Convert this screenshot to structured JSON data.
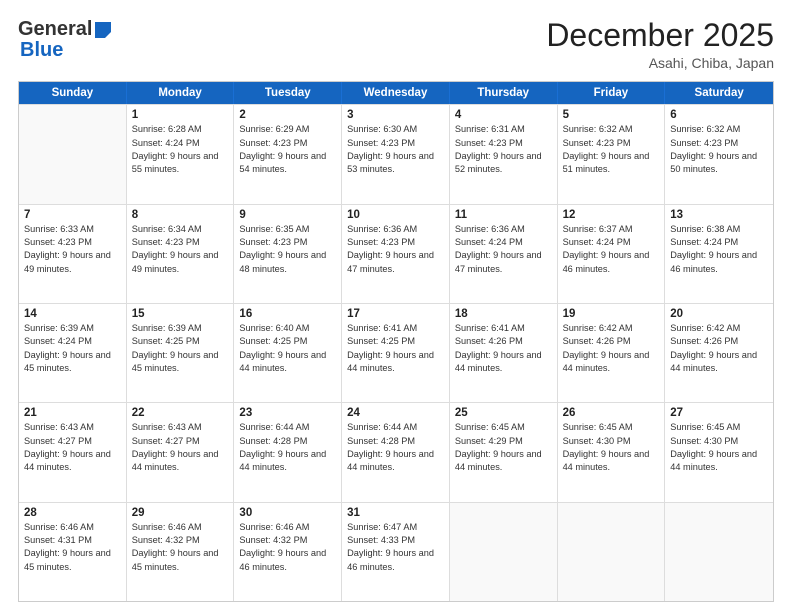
{
  "header": {
    "logo_general": "General",
    "logo_blue": "Blue",
    "month_title": "December 2025",
    "location": "Asahi, Chiba, Japan"
  },
  "weekdays": [
    "Sunday",
    "Monday",
    "Tuesday",
    "Wednesday",
    "Thursday",
    "Friday",
    "Saturday"
  ],
  "weeks": [
    [
      {
        "day": "",
        "sunrise": "",
        "sunset": "",
        "daylight": ""
      },
      {
        "day": "1",
        "sunrise": "Sunrise: 6:28 AM",
        "sunset": "Sunset: 4:24 PM",
        "daylight": "Daylight: 9 hours and 55 minutes."
      },
      {
        "day": "2",
        "sunrise": "Sunrise: 6:29 AM",
        "sunset": "Sunset: 4:23 PM",
        "daylight": "Daylight: 9 hours and 54 minutes."
      },
      {
        "day": "3",
        "sunrise": "Sunrise: 6:30 AM",
        "sunset": "Sunset: 4:23 PM",
        "daylight": "Daylight: 9 hours and 53 minutes."
      },
      {
        "day": "4",
        "sunrise": "Sunrise: 6:31 AM",
        "sunset": "Sunset: 4:23 PM",
        "daylight": "Daylight: 9 hours and 52 minutes."
      },
      {
        "day": "5",
        "sunrise": "Sunrise: 6:32 AM",
        "sunset": "Sunset: 4:23 PM",
        "daylight": "Daylight: 9 hours and 51 minutes."
      },
      {
        "day": "6",
        "sunrise": "Sunrise: 6:32 AM",
        "sunset": "Sunset: 4:23 PM",
        "daylight": "Daylight: 9 hours and 50 minutes."
      }
    ],
    [
      {
        "day": "7",
        "sunrise": "Sunrise: 6:33 AM",
        "sunset": "Sunset: 4:23 PM",
        "daylight": "Daylight: 9 hours and 49 minutes."
      },
      {
        "day": "8",
        "sunrise": "Sunrise: 6:34 AM",
        "sunset": "Sunset: 4:23 PM",
        "daylight": "Daylight: 9 hours and 49 minutes."
      },
      {
        "day": "9",
        "sunrise": "Sunrise: 6:35 AM",
        "sunset": "Sunset: 4:23 PM",
        "daylight": "Daylight: 9 hours and 48 minutes."
      },
      {
        "day": "10",
        "sunrise": "Sunrise: 6:36 AM",
        "sunset": "Sunset: 4:23 PM",
        "daylight": "Daylight: 9 hours and 47 minutes."
      },
      {
        "day": "11",
        "sunrise": "Sunrise: 6:36 AM",
        "sunset": "Sunset: 4:24 PM",
        "daylight": "Daylight: 9 hours and 47 minutes."
      },
      {
        "day": "12",
        "sunrise": "Sunrise: 6:37 AM",
        "sunset": "Sunset: 4:24 PM",
        "daylight": "Daylight: 9 hours and 46 minutes."
      },
      {
        "day": "13",
        "sunrise": "Sunrise: 6:38 AM",
        "sunset": "Sunset: 4:24 PM",
        "daylight": "Daylight: 9 hours and 46 minutes."
      }
    ],
    [
      {
        "day": "14",
        "sunrise": "Sunrise: 6:39 AM",
        "sunset": "Sunset: 4:24 PM",
        "daylight": "Daylight: 9 hours and 45 minutes."
      },
      {
        "day": "15",
        "sunrise": "Sunrise: 6:39 AM",
        "sunset": "Sunset: 4:25 PM",
        "daylight": "Daylight: 9 hours and 45 minutes."
      },
      {
        "day": "16",
        "sunrise": "Sunrise: 6:40 AM",
        "sunset": "Sunset: 4:25 PM",
        "daylight": "Daylight: 9 hours and 44 minutes."
      },
      {
        "day": "17",
        "sunrise": "Sunrise: 6:41 AM",
        "sunset": "Sunset: 4:25 PM",
        "daylight": "Daylight: 9 hours and 44 minutes."
      },
      {
        "day": "18",
        "sunrise": "Sunrise: 6:41 AM",
        "sunset": "Sunset: 4:26 PM",
        "daylight": "Daylight: 9 hours and 44 minutes."
      },
      {
        "day": "19",
        "sunrise": "Sunrise: 6:42 AM",
        "sunset": "Sunset: 4:26 PM",
        "daylight": "Daylight: 9 hours and 44 minutes."
      },
      {
        "day": "20",
        "sunrise": "Sunrise: 6:42 AM",
        "sunset": "Sunset: 4:26 PM",
        "daylight": "Daylight: 9 hours and 44 minutes."
      }
    ],
    [
      {
        "day": "21",
        "sunrise": "Sunrise: 6:43 AM",
        "sunset": "Sunset: 4:27 PM",
        "daylight": "Daylight: 9 hours and 44 minutes."
      },
      {
        "day": "22",
        "sunrise": "Sunrise: 6:43 AM",
        "sunset": "Sunset: 4:27 PM",
        "daylight": "Daylight: 9 hours and 44 minutes."
      },
      {
        "day": "23",
        "sunrise": "Sunrise: 6:44 AM",
        "sunset": "Sunset: 4:28 PM",
        "daylight": "Daylight: 9 hours and 44 minutes."
      },
      {
        "day": "24",
        "sunrise": "Sunrise: 6:44 AM",
        "sunset": "Sunset: 4:28 PM",
        "daylight": "Daylight: 9 hours and 44 minutes."
      },
      {
        "day": "25",
        "sunrise": "Sunrise: 6:45 AM",
        "sunset": "Sunset: 4:29 PM",
        "daylight": "Daylight: 9 hours and 44 minutes."
      },
      {
        "day": "26",
        "sunrise": "Sunrise: 6:45 AM",
        "sunset": "Sunset: 4:30 PM",
        "daylight": "Daylight: 9 hours and 44 minutes."
      },
      {
        "day": "27",
        "sunrise": "Sunrise: 6:45 AM",
        "sunset": "Sunset: 4:30 PM",
        "daylight": "Daylight: 9 hours and 44 minutes."
      }
    ],
    [
      {
        "day": "28",
        "sunrise": "Sunrise: 6:46 AM",
        "sunset": "Sunset: 4:31 PM",
        "daylight": "Daylight: 9 hours and 45 minutes."
      },
      {
        "day": "29",
        "sunrise": "Sunrise: 6:46 AM",
        "sunset": "Sunset: 4:32 PM",
        "daylight": "Daylight: 9 hours and 45 minutes."
      },
      {
        "day": "30",
        "sunrise": "Sunrise: 6:46 AM",
        "sunset": "Sunset: 4:32 PM",
        "daylight": "Daylight: 9 hours and 46 minutes."
      },
      {
        "day": "31",
        "sunrise": "Sunrise: 6:47 AM",
        "sunset": "Sunset: 4:33 PM",
        "daylight": "Daylight: 9 hours and 46 minutes."
      },
      {
        "day": "",
        "sunrise": "",
        "sunset": "",
        "daylight": ""
      },
      {
        "day": "",
        "sunrise": "",
        "sunset": "",
        "daylight": ""
      },
      {
        "day": "",
        "sunrise": "",
        "sunset": "",
        "daylight": ""
      }
    ]
  ]
}
